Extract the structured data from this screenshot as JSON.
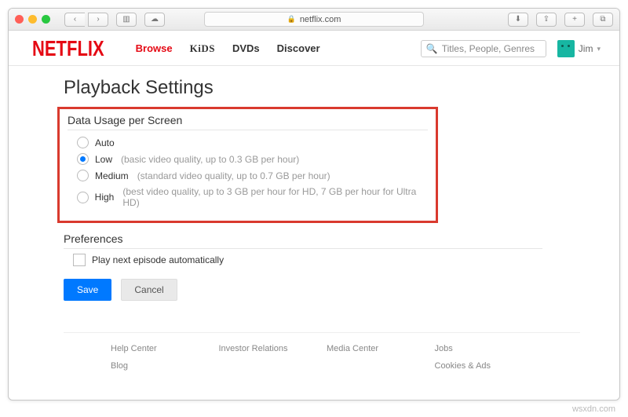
{
  "browser": {
    "url_host": "netflix.com"
  },
  "header": {
    "logo": "NETFLIX",
    "nav": {
      "browse": "Browse",
      "kids": "KiDS",
      "dvds": "DVDs",
      "discover": "Discover"
    },
    "search_placeholder": "Titles, People, Genres",
    "user_name": "Jim"
  },
  "page_title": "Playback Settings",
  "data_usage": {
    "title": "Data Usage per Screen",
    "options": [
      {
        "label": "Auto",
        "sub": "",
        "selected": false
      },
      {
        "label": "Low",
        "sub": "(basic video quality, up to 0.3 GB per hour)",
        "selected": true
      },
      {
        "label": "Medium",
        "sub": "(standard video quality, up to 0.7 GB per hour)",
        "selected": false
      },
      {
        "label": "High",
        "sub": "(best video quality, up to 3 GB per hour for HD, 7 GB per hour for Ultra HD)",
        "selected": false
      }
    ]
  },
  "preferences": {
    "title": "Preferences",
    "autoplay_label": "Play next episode automatically",
    "autoplay_checked": false
  },
  "actions": {
    "save": "Save",
    "cancel": "Cancel"
  },
  "footer": {
    "links": [
      "Help Center",
      "Investor Relations",
      "Media Center",
      "Jobs",
      "Blog",
      "",
      "",
      "Cookies & Ads"
    ]
  },
  "watermark": "wsxdn.com"
}
